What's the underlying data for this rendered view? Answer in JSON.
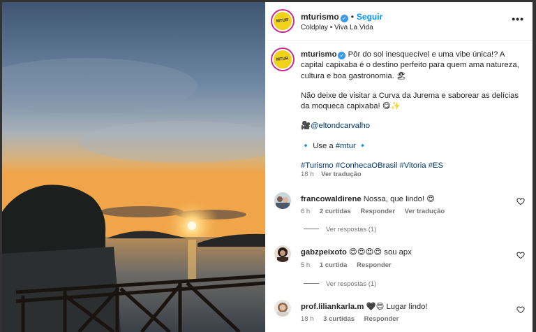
{
  "header": {
    "username": "mturismo",
    "separator": "•",
    "follow_label": "Seguir",
    "audio": "Coldplay • Viva La Vida",
    "more_icon": "more-horizontal-icon",
    "avatar_text": "MTUR"
  },
  "caption": {
    "username": "mturismo",
    "line1": "Pôr do sol inesquecível e uma vibe única!? A capital capixaba é o destino perfeito para quem ama natureza, cultura e boa gastronomia. 🏖",
    "line2": "Não deixe de visitar a Curva da Jurema e saborear as delícias da moqueca capixaba! 😋✨",
    "credit_emoji": "🎥",
    "credit_handle": "@eltondcarvalho",
    "use_prefix": "🔹 Use a",
    "use_tag": "#mtur",
    "use_suffix": "🔹",
    "hashtags": "#Turismo #ConhecaOBrasil #Vitoria #ES",
    "time": "18 h",
    "translate": "Ver tradução"
  },
  "comments": [
    {
      "username": "francowaldirene",
      "text": "Nossa, que lindo! 😍",
      "time": "6 h",
      "likes": "2 curtidas",
      "reply": "Responder",
      "translate": "Ver tradução",
      "replies": "Ver respostas (1)"
    },
    {
      "username": "gabzpeixoto",
      "text": "😍😍😍😍 sou apx",
      "time": "5 h",
      "likes": "1 curtida",
      "reply": "Responder",
      "replies": "Ver respostas (1)"
    },
    {
      "username": "prof.liliankarla.m",
      "text": "🖤😍 Lugar lindo!",
      "time": "18 h",
      "likes": "3 curtidas",
      "reply": "Responder"
    }
  ],
  "colors": {
    "accent": "#0095f6",
    "link": "#00376b",
    "muted": "#737373",
    "brand_yellow": "#f0d21a"
  }
}
